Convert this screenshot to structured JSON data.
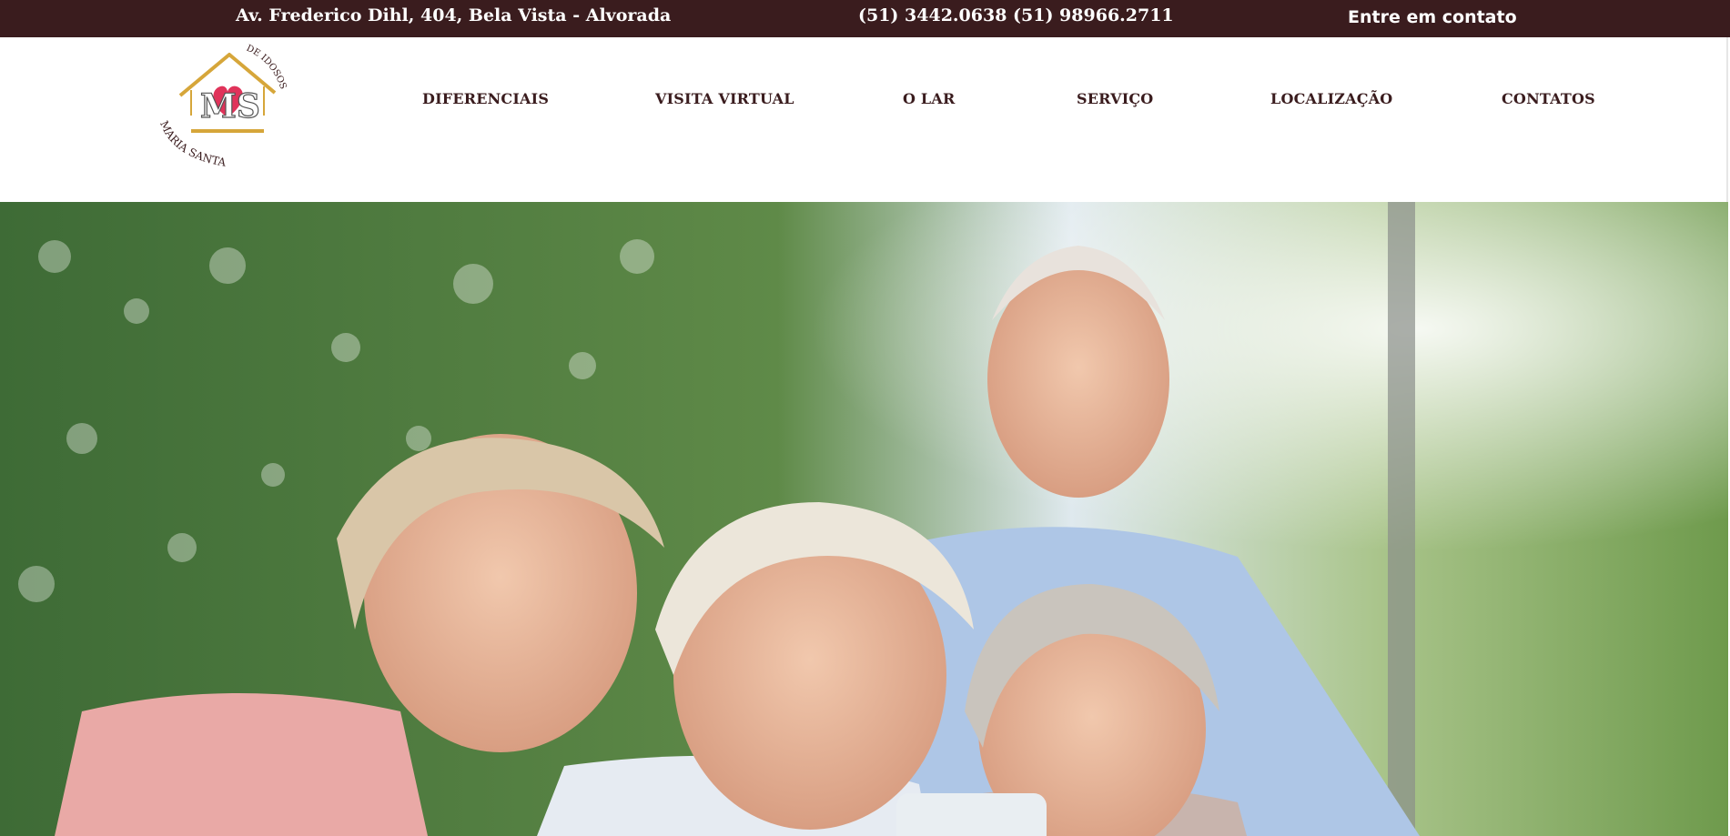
{
  "topbar": {
    "address": "Av. Frederico Dihl, 404, Bela Vista - Alvorada",
    "phones": "(51) 3442.0638 (51) 98966.2711",
    "contact_label": "Entre em contato"
  },
  "logo": {
    "arc_text_top": "DE IDOSOS",
    "monogram": "MS",
    "arc_text_bottom": "MARIA SANTA",
    "icon": "house-heart-logo"
  },
  "nav": {
    "items": [
      {
        "label": "DIFERENCIAIS"
      },
      {
        "label": "VISITA VIRTUAL"
      },
      {
        "label": "O LAR"
      },
      {
        "label": "SERVIÇO"
      },
      {
        "label": "LOCALIZAÇÃO"
      },
      {
        "label": "CONTATOS"
      }
    ]
  },
  "colors": {
    "brand_dark": "#3a1c1e",
    "logo_gold": "#d6a63a",
    "logo_heart": "#e0335a"
  }
}
